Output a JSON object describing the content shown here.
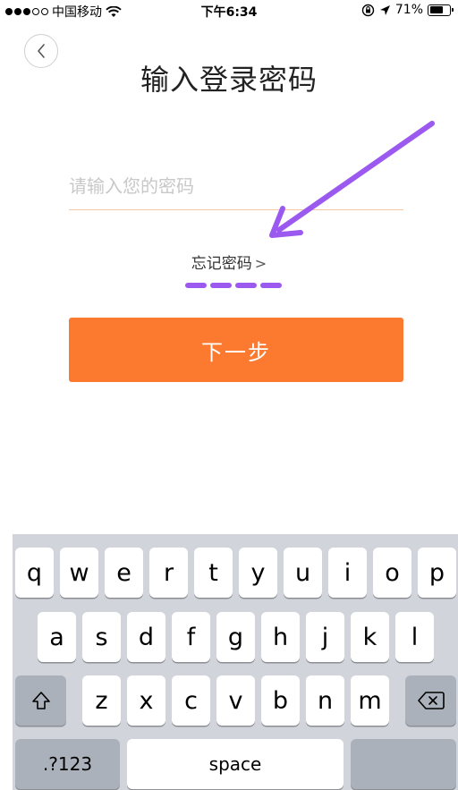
{
  "status_bar": {
    "carrier": "中国移动",
    "time": "下午6:34",
    "battery_percent": "71%",
    "battery_level": 0.71,
    "icons": [
      "signal-dots-icon",
      "wifi-icon",
      "rotation-lock-icon",
      "location-arrow-icon",
      "battery-icon"
    ]
  },
  "header": {
    "back_icon": "chevron-left-icon",
    "title": "输入登录密码"
  },
  "form": {
    "password_placeholder": "请输入您的密码",
    "password_value": "",
    "forgot_password": "忘记密码",
    "forgot_chevron": ">",
    "next_button": "下一步"
  },
  "annotation": {
    "color": "#9b59f0",
    "shapes": [
      "arrow",
      "dashed-underline"
    ]
  },
  "colors": {
    "accent": "#fb7a30",
    "field_underline": "#f3c7a3",
    "keyboard_bg": "#d1d5db"
  },
  "keyboard": {
    "row1": [
      "q",
      "w",
      "e",
      "r",
      "t",
      "y",
      "u",
      "i",
      "o",
      "p"
    ],
    "row2": [
      "a",
      "s",
      "d",
      "f",
      "g",
      "h",
      "j",
      "k",
      "l"
    ],
    "row3": [
      "z",
      "x",
      "c",
      "v",
      "b",
      "n",
      "m"
    ],
    "numbers_key": ".?123",
    "space_key": "space",
    "shift_icon": "shift-icon",
    "delete_icon": "delete-icon"
  }
}
